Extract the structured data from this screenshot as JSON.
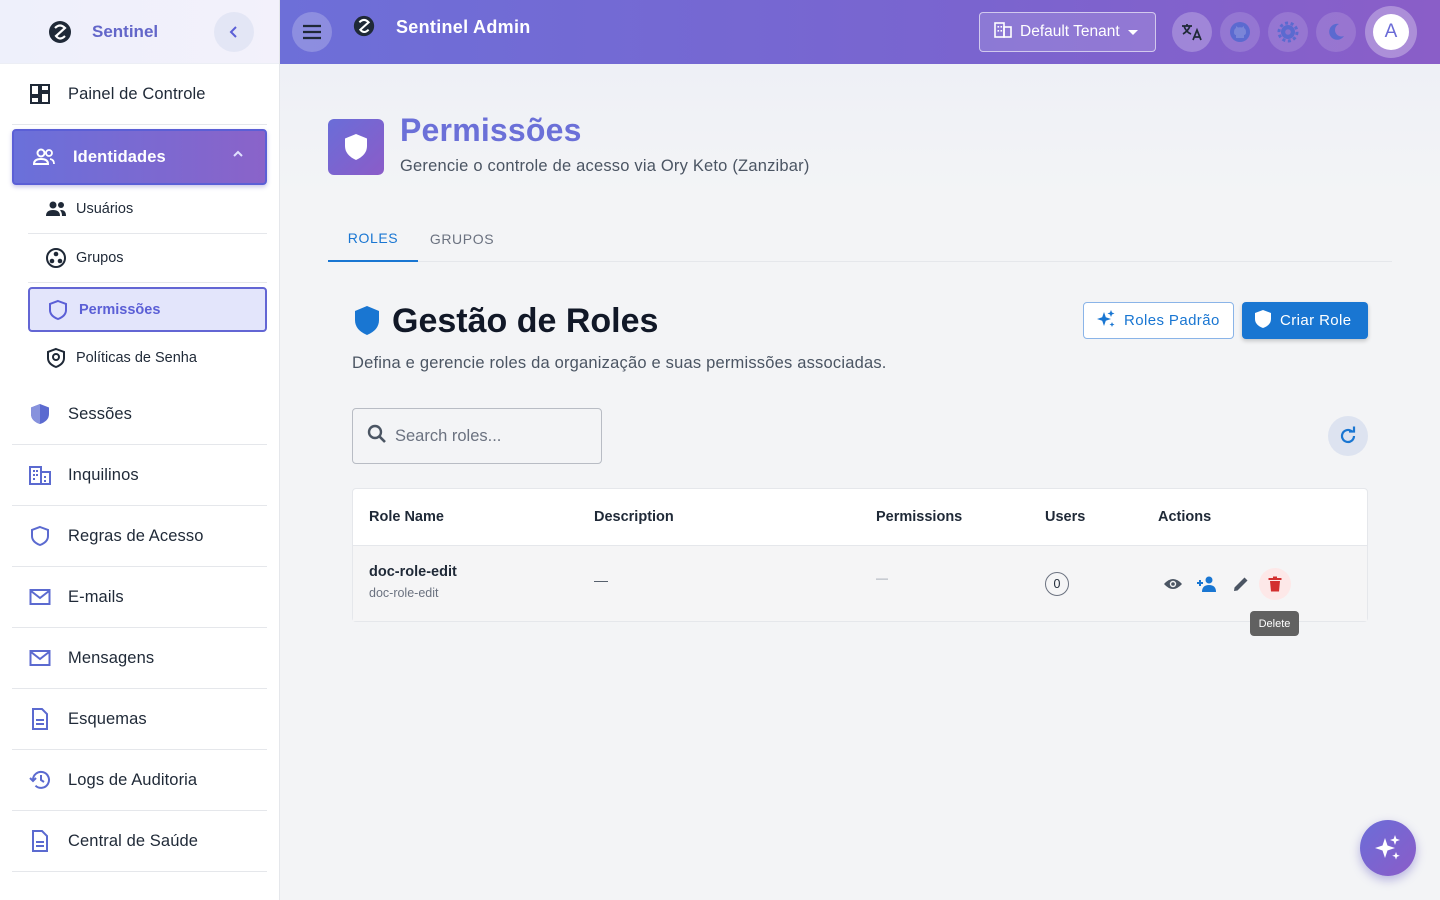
{
  "sidebar": {
    "brand": "Sentinel",
    "items": [
      {
        "label": "Painel de Controle"
      },
      {
        "label": "Identidades"
      },
      {
        "label": "Sessões"
      },
      {
        "label": "Inquilinos"
      },
      {
        "label": "Regras de Acesso"
      },
      {
        "label": "E-mails"
      },
      {
        "label": "Mensagens"
      },
      {
        "label": "Esquemas"
      },
      {
        "label": "Logs de Auditoria"
      },
      {
        "label": "Central de Saúde"
      }
    ],
    "sub_items": [
      {
        "label": "Usuários"
      },
      {
        "label": "Grupos"
      },
      {
        "label": "Permissões"
      },
      {
        "label": "Políticas de Senha"
      }
    ]
  },
  "topbar": {
    "title": "Sentinel Admin",
    "tenant": "Default Tenant",
    "avatar_initial": "A"
  },
  "page": {
    "title": "Permissões",
    "subtitle": "Gerencie o controle de acesso via Ory Keto (Zanzibar)"
  },
  "tabs": [
    {
      "label": "ROLES"
    },
    {
      "label": "GRUPOS"
    }
  ],
  "section": {
    "title": "Gestão de Roles",
    "subtitle": "Defina e gerencie roles da organização e suas permissões associadas.",
    "default_roles_label": "Roles Padrão",
    "create_role_label": "Criar Role"
  },
  "search": {
    "placeholder": "Search roles..."
  },
  "table": {
    "headers": [
      "Role Name",
      "Description",
      "Permissions",
      "Users",
      "Actions"
    ],
    "rows": [
      {
        "name": "doc-role-edit",
        "id": "doc-role-edit",
        "description": "—",
        "permissions": "—",
        "users": "0"
      }
    ]
  },
  "tooltip": "Delete",
  "colors": {
    "accent": "#6366d4",
    "primary": "#1976d2",
    "danger": "#d32f2f"
  },
  "icons": {
    "sidebar": [
      "dashboard-icon",
      "people-icon",
      "security-shield-icon",
      "domain-icon",
      "shield-outline-icon",
      "mail-icon",
      "mail-icon",
      "document-icon",
      "history-icon",
      "document-icon"
    ],
    "actions": [
      "eye-icon",
      "person-add-icon",
      "pencil-icon",
      "trash-icon"
    ]
  }
}
